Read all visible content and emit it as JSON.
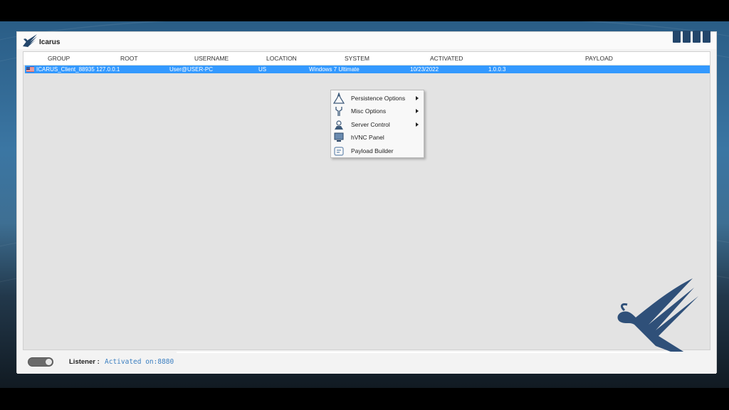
{
  "app": {
    "title": "Icarus"
  },
  "columns": [
    "GROUP",
    "ROOT",
    "USERNAME",
    "LOCATION",
    "SYSTEM",
    "ACTIVATED",
    "PAYLOAD"
  ],
  "rows": [
    {
      "group": "ICARUS_Client_88935",
      "root": "127.0.0.1",
      "username": "User@USER-PC",
      "location": "US",
      "system": "Windows 7 Ultimate",
      "activated": "10/23/2022",
      "payload": "1.0.0.3"
    }
  ],
  "context_menu": [
    {
      "label": "Persistence Options",
      "icon": "persistence-icon",
      "submenu": true
    },
    {
      "label": "Misc Options",
      "icon": "tools-icon",
      "submenu": true
    },
    {
      "label": "Server Control",
      "icon": "server-control-icon",
      "submenu": true
    },
    {
      "label": "hVNC Panel",
      "icon": "monitor-icon",
      "submenu": false
    },
    {
      "label": "Payload Builder",
      "icon": "builder-icon",
      "submenu": false
    }
  ],
  "status": {
    "listener_label": "Listener :",
    "listener_value": "Activated on:8880"
  },
  "colors": {
    "selection": "#3399ff",
    "brand": "#23466b",
    "status_value": "#3a7ec0"
  }
}
